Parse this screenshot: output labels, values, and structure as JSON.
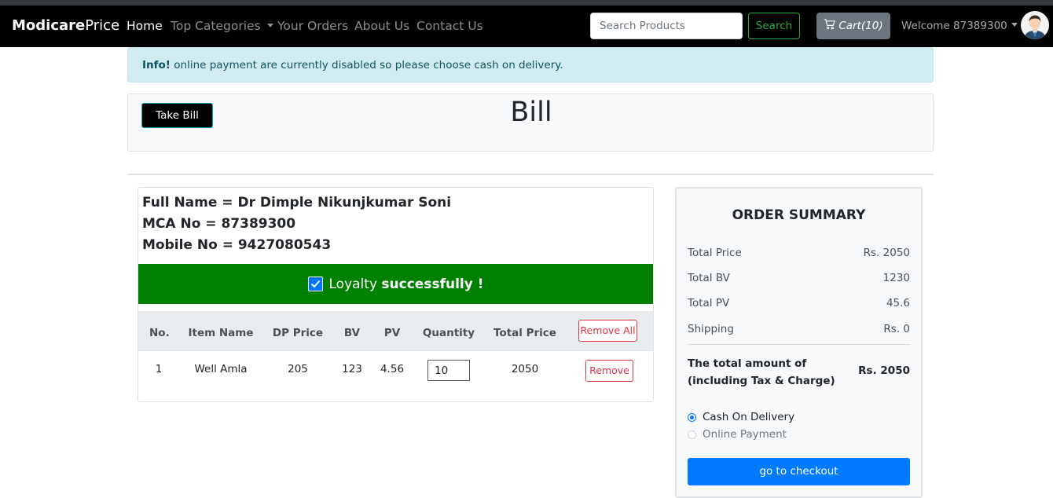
{
  "navbar": {
    "brand_bold": "Modicare",
    "brand_light": "Price",
    "links": [
      "Home",
      "Top Categories",
      "Your Orders",
      "About Us",
      "Contact Us"
    ],
    "search_placeholder": "Search Products",
    "search_button": "Search",
    "cart_label": "Cart(10)",
    "welcome": "Welcome 87389300"
  },
  "alert": {
    "strong": "Info!",
    "text": "online payment are currently disabled so please choose cash on delivery."
  },
  "bill": {
    "button": "Take Bill",
    "title": "Bill"
  },
  "customer": {
    "full_name": "Full Name = Dr Dimple Nikunjkumar Soni",
    "mca_no": "MCA No = 87389300",
    "mobile_no": "Mobile No = 9427080543"
  },
  "loyalty": {
    "prefix": "Loyalty",
    "bold": "successfully !"
  },
  "table": {
    "headers": [
      "No.",
      "Item Name",
      "DP Price",
      "BV",
      "PV",
      "Quantity",
      "Total Price"
    ],
    "remove_all": "Remove All",
    "rows": [
      {
        "no": "1",
        "item": "Well Amla",
        "dp": "205",
        "bv": "123",
        "pv": "4.56",
        "qty": "10",
        "total": "2050",
        "remove": "Remove"
      }
    ]
  },
  "summary": {
    "title": "ORDER SUMMARY",
    "rows": [
      {
        "label": "Total Price",
        "value": "Rs. 2050"
      },
      {
        "label": "Total BV",
        "value": "1230"
      },
      {
        "label": "Total PV",
        "value": "45.6"
      },
      {
        "label": "Shipping",
        "value": "Rs. 0"
      }
    ],
    "total_label": "The total amount of (including Tax & Charge)",
    "total_value": "Rs. 2050",
    "payment_options": [
      "Cash On Delivery",
      "Online Payment"
    ],
    "checkout": "go to checkout"
  },
  "colors": {
    "navbar": "#000000",
    "alert_bg": "#d1ecf1",
    "loyalty_bg": "#008000",
    "primary": "#007bff",
    "danger": "#dc3545",
    "success": "#28a745"
  },
  "icons": [
    "cart-icon",
    "avatar-icon",
    "checkbox-icon",
    "chevron-down-icon"
  ]
}
